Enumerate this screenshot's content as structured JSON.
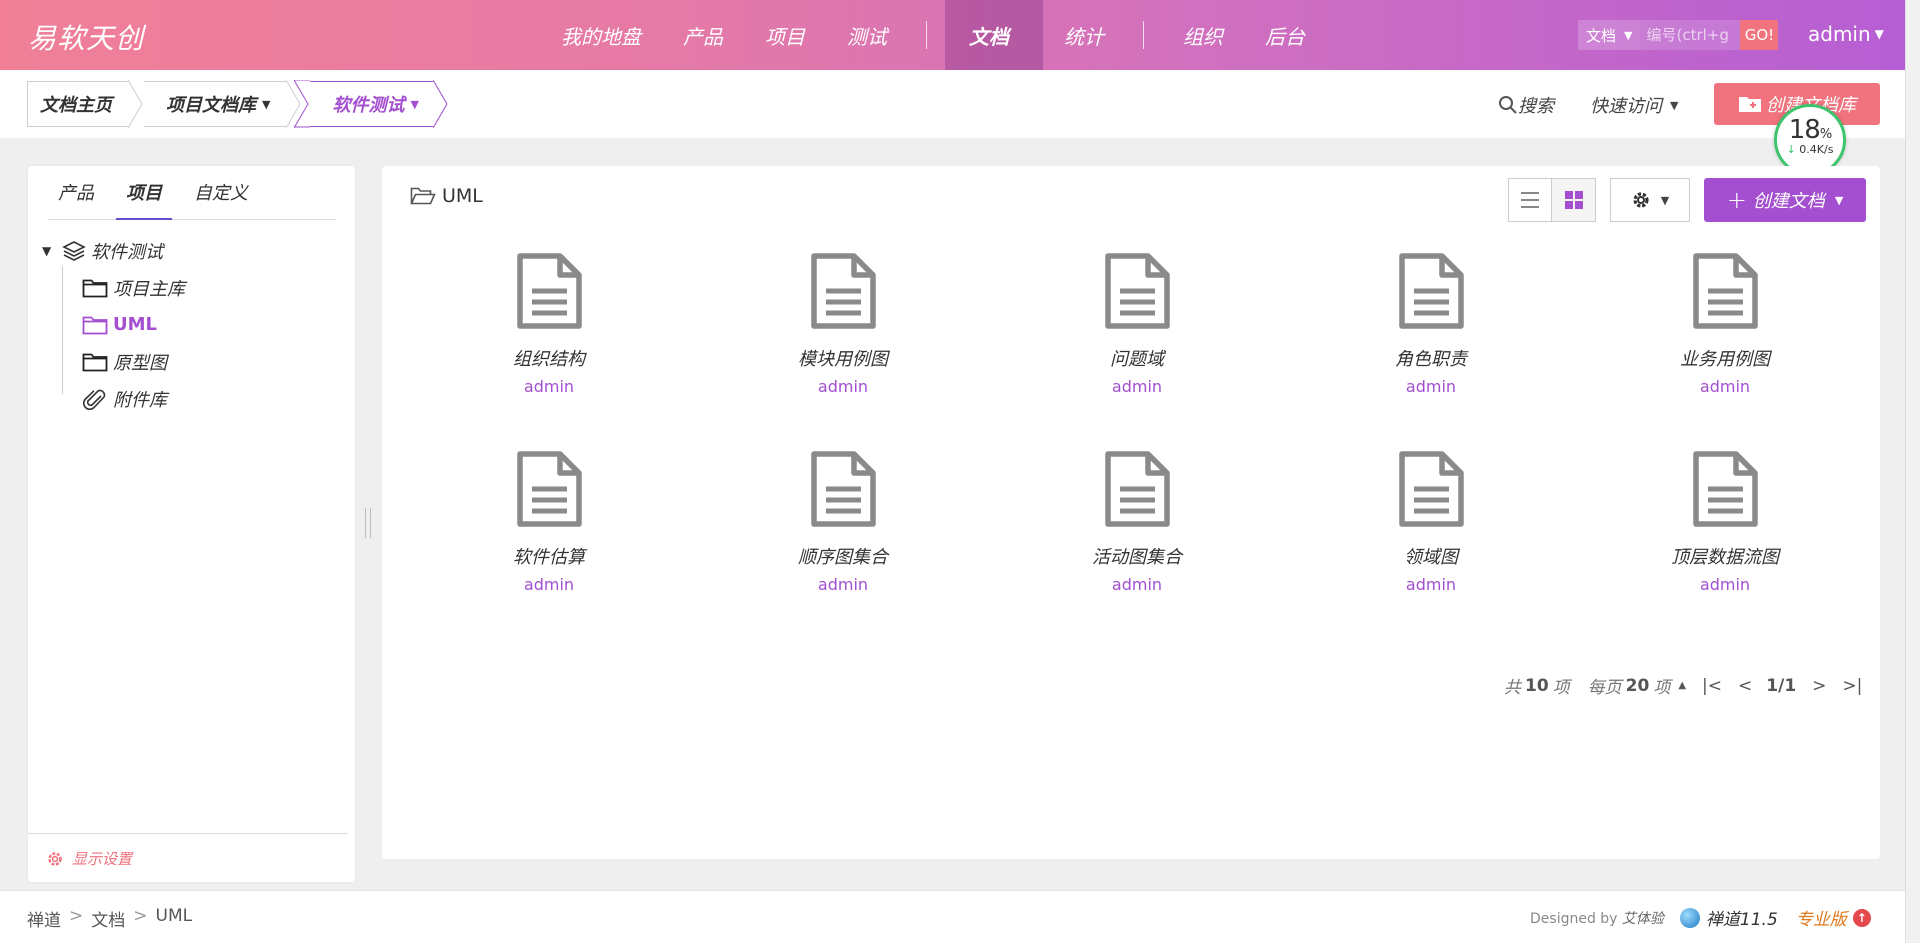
{
  "header": {
    "brand": "易软天创",
    "nav": [
      "我的地盘",
      "产品",
      "项目",
      "测试",
      "文档",
      "统计",
      "组织",
      "后台"
    ],
    "active_nav": "文档",
    "search": {
      "type": "文档",
      "placeholder": "编号(ctrl+g",
      "go": "GO!"
    },
    "user": "admin"
  },
  "subheader": {
    "crumbs": [
      "文档主页",
      "项目文档库",
      "软件测试"
    ],
    "search_label": "搜索",
    "quick_access": "快速访问",
    "create_lib": "创建文档库"
  },
  "speed_widget": {
    "percent": "18",
    "percent_sign": "%",
    "rate": "0.4K/s"
  },
  "sidebar": {
    "tabs": [
      "产品",
      "项目",
      "自定义"
    ],
    "active_tab": "项目",
    "tree": {
      "root": "软件测试",
      "children": [
        "项目主库",
        "UML",
        "原型图",
        "附件库"
      ],
      "active": "UML"
    },
    "display_settings": "显示设置"
  },
  "main": {
    "folder": "UML",
    "create_doc": "创建文档",
    "docs": [
      {
        "title": "组织结构",
        "author": "admin"
      },
      {
        "title": "模块用例图",
        "author": "admin"
      },
      {
        "title": "问题域",
        "author": "admin"
      },
      {
        "title": "角色职责",
        "author": "admin"
      },
      {
        "title": "业务用例图",
        "author": "admin"
      },
      {
        "title": "软件估算",
        "author": "admin"
      },
      {
        "title": "顺序图集合",
        "author": "admin"
      },
      {
        "title": "活动图集合",
        "author": "admin"
      },
      {
        "title": "领域图",
        "author": "admin"
      },
      {
        "title": "顶层数据流图",
        "author": "admin"
      }
    ],
    "pager": {
      "total_prefix": "共",
      "total": "10",
      "total_suffix": "项",
      "per_page_prefix": "每页",
      "per_page": "20",
      "per_page_suffix": "项",
      "page": "1/1"
    }
  },
  "footer": {
    "crumbs": [
      "禅道",
      "文档",
      "UML"
    ],
    "designed_by": "Designed by",
    "designer": "艾体验",
    "version": "禅道11.5",
    "edition": "专业版"
  },
  "colors": {
    "accent": "#a34fd0",
    "primary_pink": "#f0737e",
    "header_start": "#f07f97",
    "header_end": "#b65ed4"
  }
}
